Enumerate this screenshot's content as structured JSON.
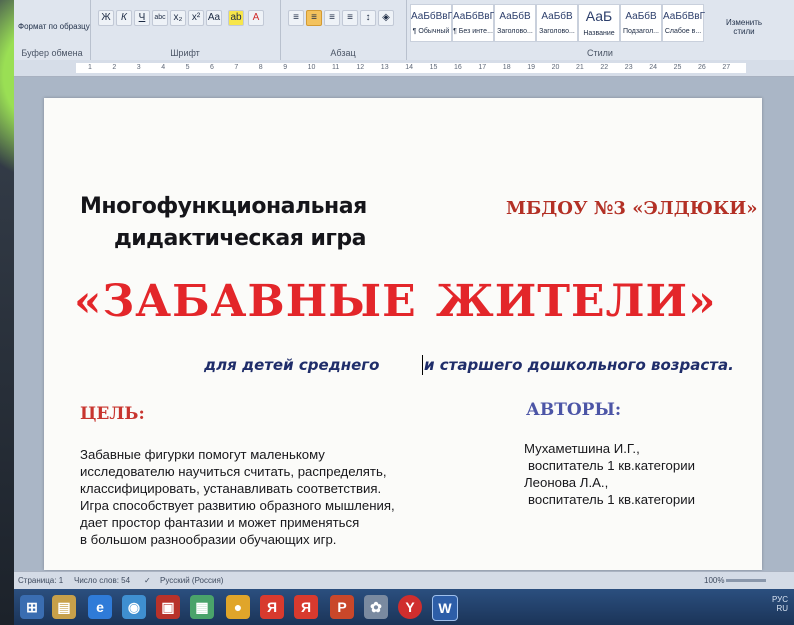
{
  "ribbon": {
    "format_painter": "Формат по образцу",
    "group_clipboard": "Буфер обмена",
    "group_font": "Шрифт",
    "group_paragraph": "Абзац",
    "group_styles": "Стили",
    "font_tools": [
      "Ж",
      "К",
      "Ч",
      "abc",
      "x₂",
      "x²",
      "Aa"
    ],
    "styles": [
      {
        "sample": "АаБбВвГ",
        "name": "¶ Обычный"
      },
      {
        "sample": "АаБбВвГ",
        "name": "¶ Без инте..."
      },
      {
        "sample": "АаБбВ",
        "name": "Заголово..."
      },
      {
        "sample": "АаБбВ",
        "name": "Заголово..."
      },
      {
        "sample": "АаБ",
        "name": "Название"
      },
      {
        "sample": "АаБбВ",
        "name": "Подзагол..."
      },
      {
        "sample": "АаБбВвГ",
        "name": "Слабое в..."
      }
    ],
    "change_styles": "Изменить стили"
  },
  "ruler": {
    "ticks": [
      "1",
      "2",
      "3",
      "4",
      "5",
      "6",
      "7",
      "8",
      "9",
      "10",
      "11",
      "12",
      "13",
      "14",
      "15",
      "16",
      "17",
      "18",
      "19",
      "20",
      "21",
      "22",
      "23",
      "24",
      "25",
      "26",
      "27"
    ]
  },
  "document": {
    "title_line1": "Многофункциональная",
    "title_line2": "дидактическая игра",
    "school": "МБДОУ №3 «ЭЛДЮКИ»",
    "big_left": "«ЗАБАВНЫЕ",
    "big_right": "ЖИТЕЛИ»",
    "sub_left": "для детей среднего",
    "sub_right": "и старшего дошкольного возраста.",
    "goal_heading": "ЦЕЛЬ:",
    "goal_lines": [
      "Забавные фигурки помогут маленькому",
      "исследователю научиться считать, распределять,",
      "классифицировать, устанавливать соответствия.",
      "Игра способствует развитию образного мышления,",
      "дает простор фантазии и может применяться",
      "в большом разнообразии обучающих игр."
    ],
    "authors_heading": "АВТОРЫ:",
    "authors_lines": [
      "Мухаметшина И.Г.,",
      "воспитатель 1 кв.категории",
      "Леонова Л.А.,",
      "воспитатель 1 кв.категории"
    ]
  },
  "status": {
    "page": "Страница: 1",
    "words": "Число слов: 54",
    "language": "Русский (Россия)",
    "zoom": "100%"
  },
  "taskbar": {
    "lang": "РУС",
    "region": "RU"
  },
  "colors": {
    "accent_red": "#e3262a",
    "heading_blue": "#4c55a6",
    "subtitle_navy": "#1f2d6a"
  }
}
